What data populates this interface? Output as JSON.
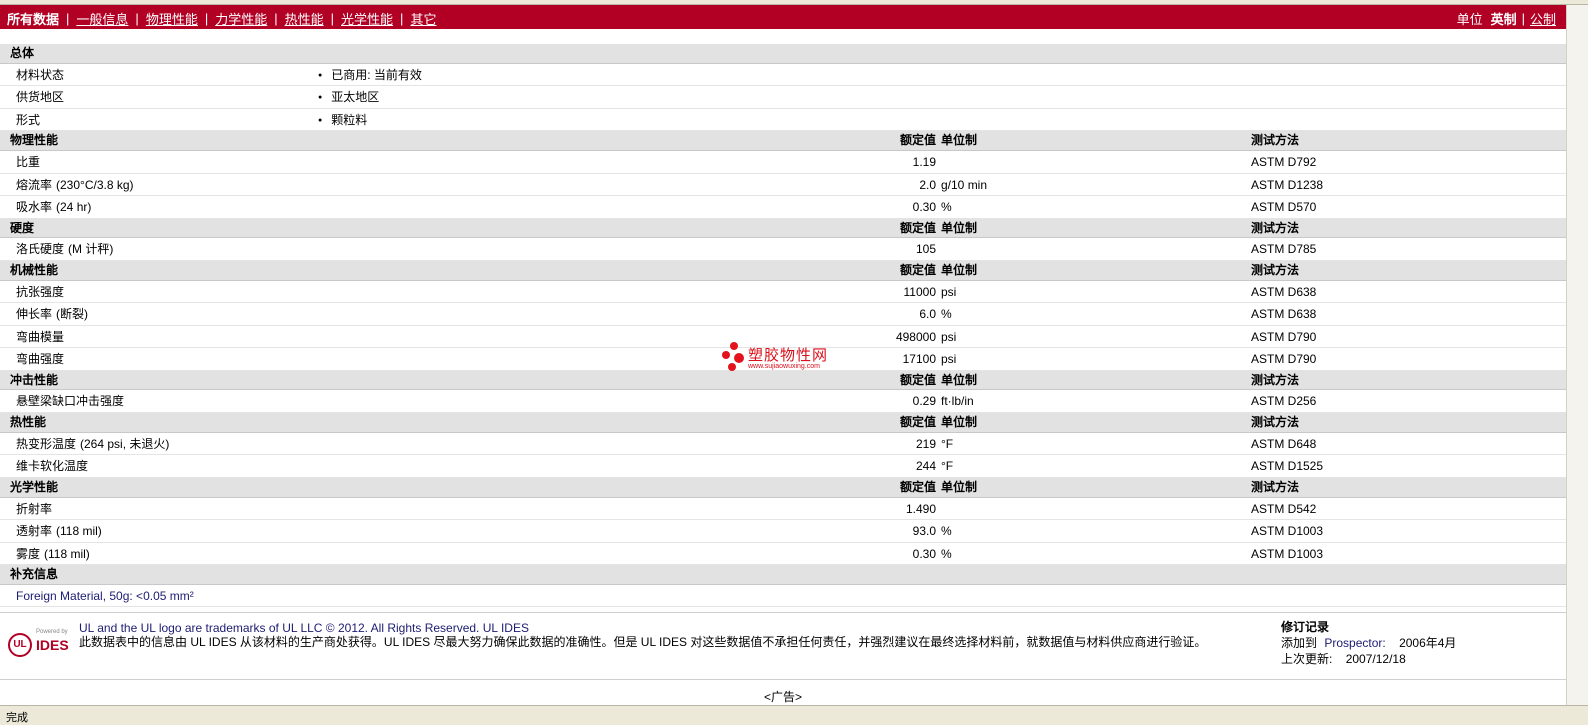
{
  "nav": {
    "tabs": [
      "所有数据",
      "一般信息",
      "物理性能",
      "力学性能",
      "热性能",
      "光学性能",
      "其它"
    ],
    "units_label": "单位",
    "units_imperial": "英制",
    "units_metric": "公制"
  },
  "colors": {
    "brand": "#b10024",
    "header_bg": "#e2e2e2",
    "link_blue": "#1c1c72"
  },
  "sections": {
    "general": {
      "title": "总体",
      "rows": [
        {
          "label": "材料状态",
          "value": "已商用: 当前有效"
        },
        {
          "label": "供货地区",
          "value": "亚太地区"
        },
        {
          "label": "形式",
          "value": "颗粒料"
        }
      ]
    },
    "physical": {
      "title": "物理性能",
      "col_value": "额定值",
      "col_unit": "单位制",
      "col_method": "测试方法",
      "rows": [
        {
          "label": "比重",
          "cond": "",
          "value": "1.19",
          "unit": "",
          "method": "ASTM D792"
        },
        {
          "label": "熔流率",
          "cond": "(230°C/3.8 kg)",
          "value": "2.0",
          "unit": "g/10 min",
          "method": "ASTM D1238"
        },
        {
          "label": "吸水率",
          "cond": "(24 hr)",
          "value": "0.30",
          "unit": "%",
          "method": "ASTM D570"
        }
      ]
    },
    "hardness": {
      "title": "硬度",
      "col_value": "额定值",
      "col_unit": "单位制",
      "col_method": "测试方法",
      "rows": [
        {
          "label": "洛氏硬度",
          "cond": "(M 计秤)",
          "value": "105",
          "unit": "",
          "method": "ASTM D785"
        }
      ]
    },
    "mechanical": {
      "title": "机械性能",
      "col_value": "额定值",
      "col_unit": "单位制",
      "col_method": "测试方法",
      "rows": [
        {
          "label": "抗张强度",
          "cond": "",
          "value": "11000",
          "unit": "psi",
          "method": "ASTM D638"
        },
        {
          "label": "伸长率",
          "cond": "(断裂)",
          "value": "6.0",
          "unit": "%",
          "method": "ASTM D638"
        },
        {
          "label": "弯曲模量",
          "cond": "",
          "value": "498000",
          "unit": "psi",
          "method": "ASTM D790"
        },
        {
          "label": "弯曲强度",
          "cond": "",
          "value": "17100",
          "unit": "psi",
          "method": "ASTM D790"
        }
      ]
    },
    "impact": {
      "title": "冲击性能",
      "col_value": "额定值",
      "col_unit": "单位制",
      "col_method": "测试方法",
      "rows": [
        {
          "label": "悬壁梁缺口冲击强度",
          "cond": "",
          "value": "0.29",
          "unit": "ft·lb/in",
          "method": "ASTM D256"
        }
      ]
    },
    "thermal": {
      "title": "热性能",
      "col_value": "额定值",
      "col_unit": "单位制",
      "col_method": "测试方法",
      "rows": [
        {
          "label": "热变形温度",
          "cond": "(264 psi, 未退火)",
          "value": "219",
          "unit": "°F",
          "method": "ASTM D648"
        },
        {
          "label": "维卡软化温度",
          "cond": "",
          "value": "244",
          "unit": "°F",
          "method": "ASTM D1525"
        }
      ]
    },
    "optical": {
      "title": "光学性能",
      "col_value": "额定值",
      "col_unit": "单位制",
      "col_method": "测试方法",
      "rows": [
        {
          "label": "折射率",
          "cond": "",
          "value": "1.490",
          "unit": "",
          "method": "ASTM D542"
        },
        {
          "label": "透射率",
          "cond": "(118 mil)",
          "value": "93.0",
          "unit": "%",
          "method": "ASTM D1003"
        },
        {
          "label": "雾度",
          "cond": "(118 mil)",
          "value": "0.30",
          "unit": "%",
          "method": "ASTM D1003"
        }
      ]
    },
    "supplement": {
      "title": "补充信息",
      "note": "Foreign Material, 50g: <0.05 mm²"
    }
  },
  "watermark": {
    "title": "塑胶物性网",
    "url": "www.sujiaowuxing.com"
  },
  "footer": {
    "logo_ul": "UL",
    "logo_powered": "Powered by",
    "logo_ides": "IDES",
    "legal_line1": "UL and the UL logo are trademarks of UL LLC © 2012. All Rights Reserved. UL IDES",
    "legal_line2": "此数据表中的信息由 UL IDES 从该材料的生产商处获得。UL IDES 尽最大努力确保此数据的准确性。但是 UL IDES 对这些数据值不承担任何责任，并强烈建议在最终选择材料前，就数据值与材料供应商进行验证。",
    "rev_title": "修订记录",
    "rev_added_label": "添加到",
    "rev_added_source": "Prospector:",
    "rev_added_date": "2006年4月",
    "rev_updated_label": "上次更新:",
    "rev_updated_date": "2007/12/18"
  },
  "ad": "<广告>",
  "status": "完成"
}
